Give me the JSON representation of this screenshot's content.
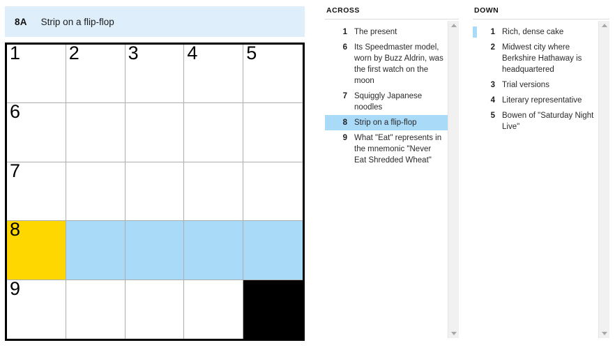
{
  "current_clue": {
    "number_label": "8A",
    "text": "Strip on a flip-flop"
  },
  "colors": {
    "cursor_cell": "#FFD700",
    "highlight_cell": "#A9DAF8",
    "clue_bar_bg": "#DFEEFB",
    "black_cell": "#000000",
    "grid_border": "#000000",
    "grid_line": "#ADADAD"
  },
  "grid": {
    "rows": 5,
    "cols": 5,
    "cells": [
      [
        {
          "number": "1",
          "letter": "",
          "state": "empty"
        },
        {
          "number": "2",
          "letter": "",
          "state": "empty"
        },
        {
          "number": "3",
          "letter": "",
          "state": "empty"
        },
        {
          "number": "4",
          "letter": "",
          "state": "empty"
        },
        {
          "number": "5",
          "letter": "",
          "state": "empty"
        }
      ],
      [
        {
          "number": "6",
          "letter": "",
          "state": "empty"
        },
        {
          "number": "",
          "letter": "",
          "state": "empty"
        },
        {
          "number": "",
          "letter": "",
          "state": "empty"
        },
        {
          "number": "",
          "letter": "",
          "state": "empty"
        },
        {
          "number": "",
          "letter": "",
          "state": "empty"
        }
      ],
      [
        {
          "number": "7",
          "letter": "",
          "state": "empty"
        },
        {
          "number": "",
          "letter": "",
          "state": "empty"
        },
        {
          "number": "",
          "letter": "",
          "state": "empty"
        },
        {
          "number": "",
          "letter": "",
          "state": "empty"
        },
        {
          "number": "",
          "letter": "",
          "state": "empty"
        }
      ],
      [
        {
          "number": "8",
          "letter": "",
          "state": "cursor"
        },
        {
          "number": "",
          "letter": "",
          "state": "highlight"
        },
        {
          "number": "",
          "letter": "",
          "state": "highlight"
        },
        {
          "number": "",
          "letter": "",
          "state": "highlight"
        },
        {
          "number": "",
          "letter": "",
          "state": "highlight"
        }
      ],
      [
        {
          "number": "9",
          "letter": "",
          "state": "empty"
        },
        {
          "number": "",
          "letter": "",
          "state": "empty"
        },
        {
          "number": "",
          "letter": "",
          "state": "empty"
        },
        {
          "number": "",
          "letter": "",
          "state": "empty"
        },
        {
          "number": "",
          "letter": "",
          "state": "black"
        }
      ]
    ]
  },
  "across": {
    "title": "ACROSS",
    "clues": [
      {
        "number": "1",
        "text": "The present",
        "selected": false,
        "marked": false
      },
      {
        "number": "6",
        "text": "Its Speedmaster model, worn by Buzz Aldrin, was the first watch on the moon",
        "selected": false,
        "marked": false
      },
      {
        "number": "7",
        "text": "Squiggly Japanese noodles",
        "selected": false,
        "marked": false
      },
      {
        "number": "8",
        "text": "Strip on a flip-flop",
        "selected": true,
        "marked": false
      },
      {
        "number": "9",
        "text": "What \"Eat\" represents in the mnemonic \"Never Eat Shredded Wheat\"",
        "selected": false,
        "marked": false
      }
    ]
  },
  "down": {
    "title": "DOWN",
    "clues": [
      {
        "number": "1",
        "text": "Rich, dense cake",
        "selected": false,
        "marked": true
      },
      {
        "number": "2",
        "text": "Midwest city where Berkshire Hathaway is headquartered",
        "selected": false,
        "marked": false
      },
      {
        "number": "3",
        "text": "Trial versions",
        "selected": false,
        "marked": false
      },
      {
        "number": "4",
        "text": "Literary representative",
        "selected": false,
        "marked": false
      },
      {
        "number": "5",
        "text": "Bowen of \"Saturday Night Live\"",
        "selected": false,
        "marked": false
      }
    ]
  },
  "scrollbars": {
    "up_arrow_icon": "triangle-up-icon",
    "down_arrow_icon": "triangle-down-icon"
  }
}
